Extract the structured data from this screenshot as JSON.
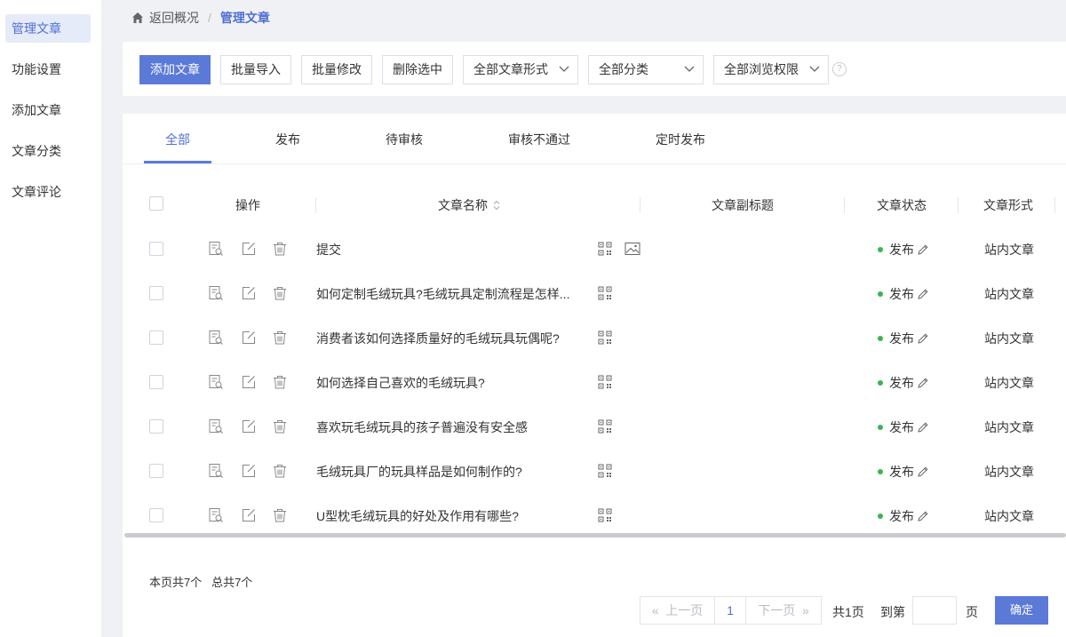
{
  "sidebar": {
    "items": [
      {
        "label": "管理文章"
      },
      {
        "label": "功能设置"
      },
      {
        "label": "添加文章"
      },
      {
        "label": "文章分类"
      },
      {
        "label": "文章评论"
      }
    ]
  },
  "breadcrumb": {
    "back": "返回概况",
    "sep": "/",
    "current": "管理文章"
  },
  "toolbar": {
    "add": "添加文章",
    "batch_import": "批量导入",
    "batch_edit": "批量修改",
    "delete_selected": "删除选中",
    "form_select": "全部文章形式",
    "category_select": "全部分类",
    "permission_select": "全部浏览权限",
    "help": "?"
  },
  "tabs": [
    "全部",
    "发布",
    "待审核",
    "审核不通过",
    "定时发布"
  ],
  "table": {
    "headers": {
      "ops": "操作",
      "name": "文章名称",
      "subtitle": "文章副标题",
      "status": "文章状态",
      "form": "文章形式"
    },
    "rows": [
      {
        "title": "提交",
        "status": "发布",
        "form": "站内文章"
      },
      {
        "title": "如何定制毛绒玩具?毛绒玩具定制流程是怎样...",
        "status": "发布",
        "form": "站内文章"
      },
      {
        "title": "消费者该如何选择质量好的毛绒玩具玩偶呢?",
        "status": "发布",
        "form": "站内文章"
      },
      {
        "title": "如何选择自己喜欢的毛绒玩具?",
        "status": "发布",
        "form": "站内文章"
      },
      {
        "title": "喜欢玩毛绒玩具的孩子普遍没有安全感",
        "status": "发布",
        "form": "站内文章"
      },
      {
        "title": "毛绒玩具厂的玩具样品是如何制作的?",
        "status": "发布",
        "form": "站内文章"
      },
      {
        "title": "U型枕毛绒玩具的好处及作用有哪些?",
        "status": "发布",
        "form": "站内文章"
      }
    ]
  },
  "footer": {
    "page_count": "本页共7个",
    "total_count": "总共7个",
    "prev": "上一页",
    "page": "1",
    "next": "下一页",
    "total_pages": "共1页",
    "goto": "到第",
    "page_unit": "页",
    "confirm": "确定"
  },
  "colors": {
    "accent": "#5b7ad8",
    "status_dot": "#3cb44b",
    "background": "#f0f1f4"
  }
}
